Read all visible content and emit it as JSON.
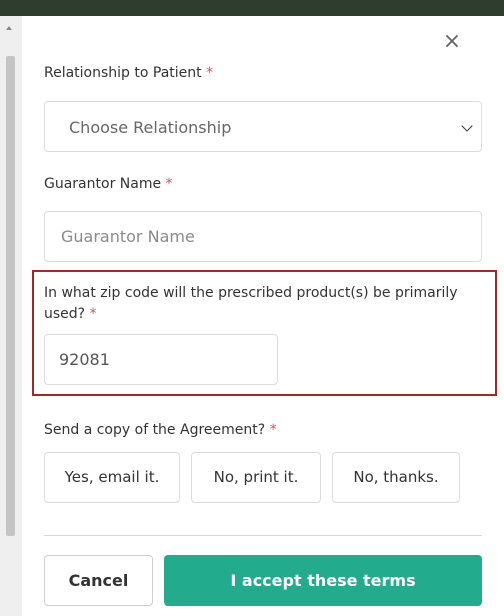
{
  "modal": {
    "close_glyph": "×",
    "required_mark": "*"
  },
  "relationship": {
    "label": "Relationship to Patient",
    "selected": "Choose Relationship"
  },
  "guarantor": {
    "label": "Guarantor Name",
    "placeholder": "Guarantor Name"
  },
  "zip": {
    "label": "In what zip code will the prescribed product(s) be primarily used?",
    "value": "92081"
  },
  "agreement_copy": {
    "label": "Send a copy of the Agreement?",
    "options": [
      "Yes, email it.",
      "No, print it.",
      "No, thanks."
    ]
  },
  "footer": {
    "cancel_label": "Cancel",
    "accept_label": "I accept these terms"
  },
  "colors": {
    "accent": "#23ab8e",
    "required": "#d9534f",
    "highlight_border": "#a32727"
  }
}
